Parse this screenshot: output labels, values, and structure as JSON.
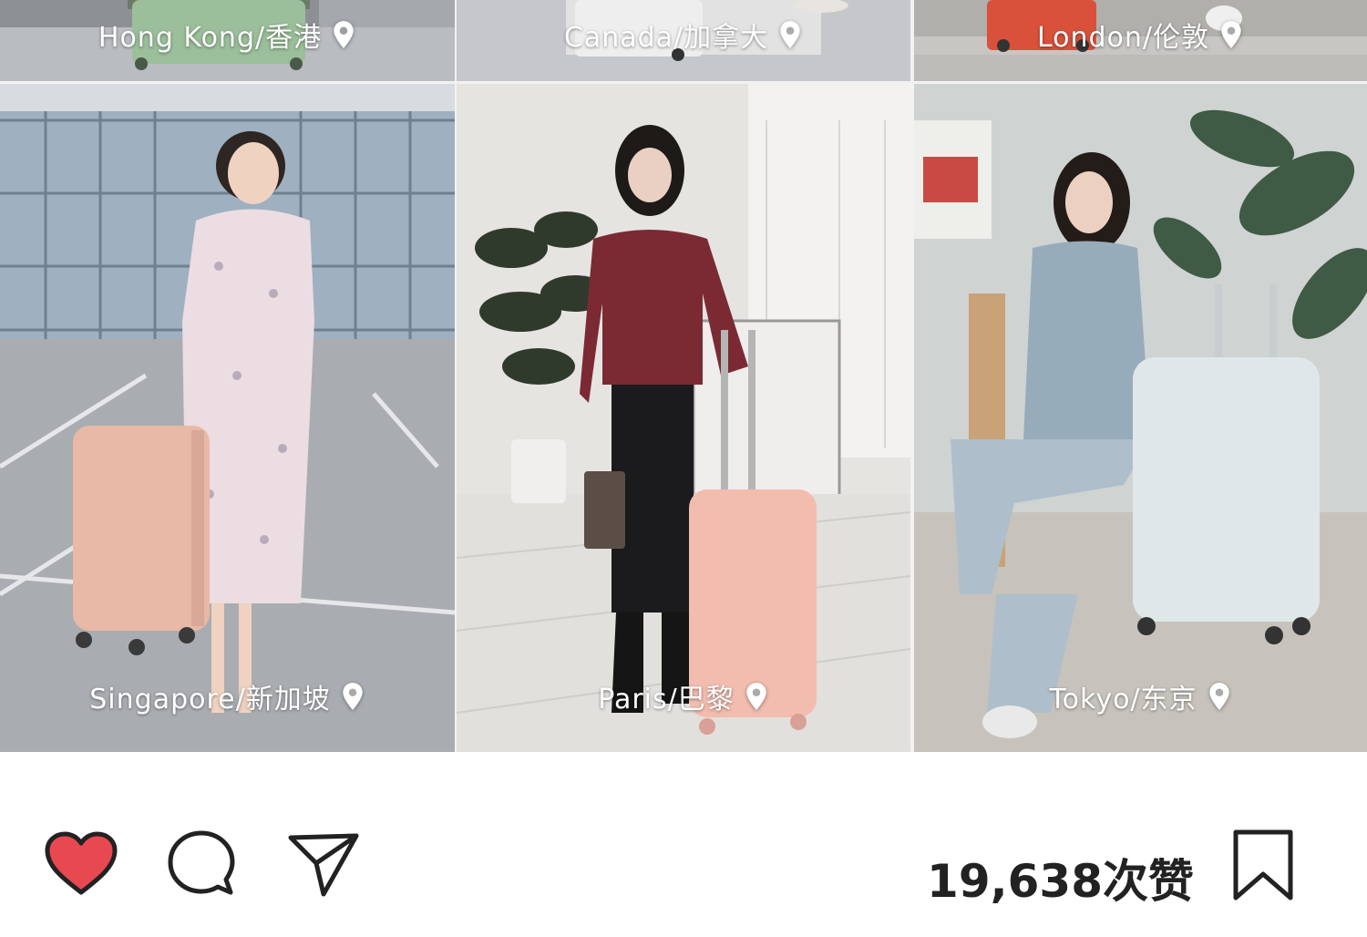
{
  "posts": [
    {
      "location": "Hong Kong/香港"
    },
    {
      "location": "Canada/加拿大"
    },
    {
      "location": "London/伦敦"
    },
    {
      "location": "Singapore/新加坡"
    },
    {
      "location": "Paris/巴黎"
    },
    {
      "location": "Tokyo/东京"
    }
  ],
  "actions": {
    "like_icon": "heart-icon",
    "comment_icon": "comment-icon",
    "share_icon": "send-icon",
    "save_icon": "bookmark-icon",
    "likes_text": "19,638次赞"
  },
  "colors": {
    "heart": "#e8484f",
    "icon_stroke": "#222222"
  }
}
